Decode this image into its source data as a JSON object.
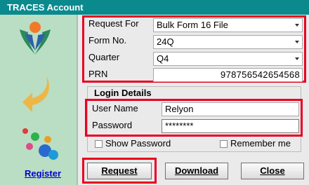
{
  "window": {
    "title": "TRACES Account"
  },
  "sidebar": {
    "register_link": "Register",
    "icons": [
      "traces-logo-icon",
      "curved-arrow-icon",
      "colored-dots-icon"
    ]
  },
  "form": {
    "request_for": {
      "label": "Request For",
      "value": "Bulk Form 16 File"
    },
    "form_no": {
      "label": "Form No.",
      "value": "24Q"
    },
    "quarter": {
      "label": "Quarter",
      "value": "Q4"
    },
    "prn": {
      "label": "PRN",
      "value": "978756542654568"
    }
  },
  "login": {
    "title": "Login Details",
    "username": {
      "label": "User Name",
      "value": "Relyon"
    },
    "password": {
      "label": "Password",
      "value": "********"
    },
    "show_password": "Show Password",
    "remember_me": "Remember me"
  },
  "buttons": {
    "request": "Request",
    "download": "Download",
    "close": "Close"
  },
  "colors": {
    "titlebar": "#0b8a8e",
    "sidebar": "#b9dec3",
    "highlight": "#e8001f"
  }
}
